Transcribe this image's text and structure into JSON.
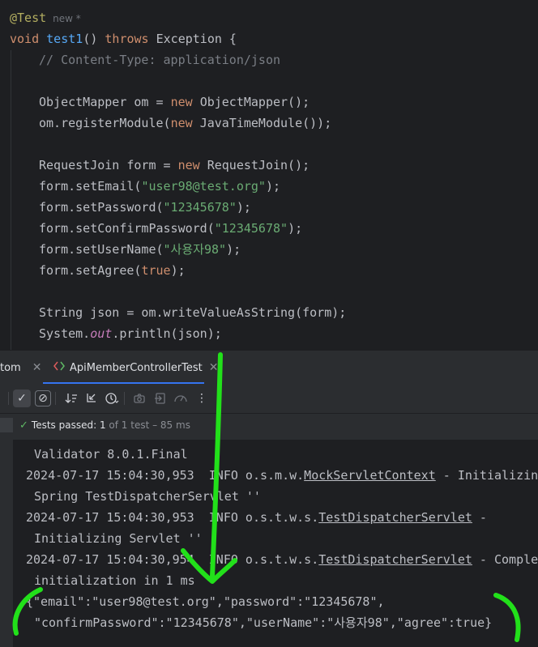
{
  "editor": {
    "annotation": "@Test",
    "annotation_hint": "new *",
    "kw_void": "void",
    "method_name": "test1",
    "method_parens": "()",
    "kw_throws": "throws",
    "exception_tail": "Exception {",
    "comment": "// Content-Type: application/json",
    "om_decl": "ObjectMapper om = ",
    "kw_new": "new",
    "om_ctor": "ObjectMapper();",
    "register_pre": "om.registerModule(",
    "register_post": "JavaTimeModule());",
    "form_decl": "RequestJoin form = ",
    "form_ctor": "RequestJoin();",
    "set_email_pre": "form.setEmail(",
    "email_value": "\"user98@test.org\"",
    "set_password_pre": "form.setPassword(",
    "password_value": "\"12345678\"",
    "set_confirm_pre": "form.setConfirmPassword(",
    "confirm_value": "\"12345678\"",
    "set_username_pre": "form.setUserName(",
    "username_value": "\"사용자98\"",
    "set_agree_pre": "form.setAgree(",
    "agree_value": "true",
    "call_end": ");",
    "json_decl": "String json = om.writeValueAsString(form);",
    "sysout_pre": "System.",
    "sysout_field": "out",
    "sysout_post": ".println(json);"
  },
  "tabs": {
    "partial_label": "tom",
    "active_label": "ApiMemberControllerTest",
    "close_glyph": "✕"
  },
  "toolbar": {
    "check_icon": "✓",
    "stop_icon": "⊘"
  },
  "status": {
    "passed_label": "Tests passed:",
    "passed_count": "1",
    "of_text": "of 1 test – 85 ms"
  },
  "console": {
    "line1": "Validator 8.0.1.Final",
    "line2_pre": "2024-07-17 15:04:30,953  INFO o.s.m.w.",
    "line2_link": "MockServletContext",
    "line2_post": " - Initializing",
    "line3": "Spring TestDispatcherServlet ''",
    "line4_pre": "2024-07-17 15:04:30,953  INFO o.s.t.w.s.",
    "line4_link": "TestDispatcherServlet",
    "line4_post": " -",
    "line5": "Initializing Servlet ''",
    "line6_pre": "2024-07-17 15:04:30,954  INFO o.s.t.w.s.",
    "line6_link": "TestDispatcherServlet",
    "line6_post": " - Complet",
    "line7": "initialization in 1 ms",
    "line8": "{\"email\":\"user98@test.org\",\"password\":\"12345678\",",
    "line9": "\"confirmPassword\":\"12345678\",\"userName\":\"사용자98\",\"agree\":true}"
  },
  "colors": {
    "bg": "#1e1f22",
    "panel": "#2b2d30",
    "accent": "#3574f0",
    "annotation_marker": "#22e01a"
  }
}
